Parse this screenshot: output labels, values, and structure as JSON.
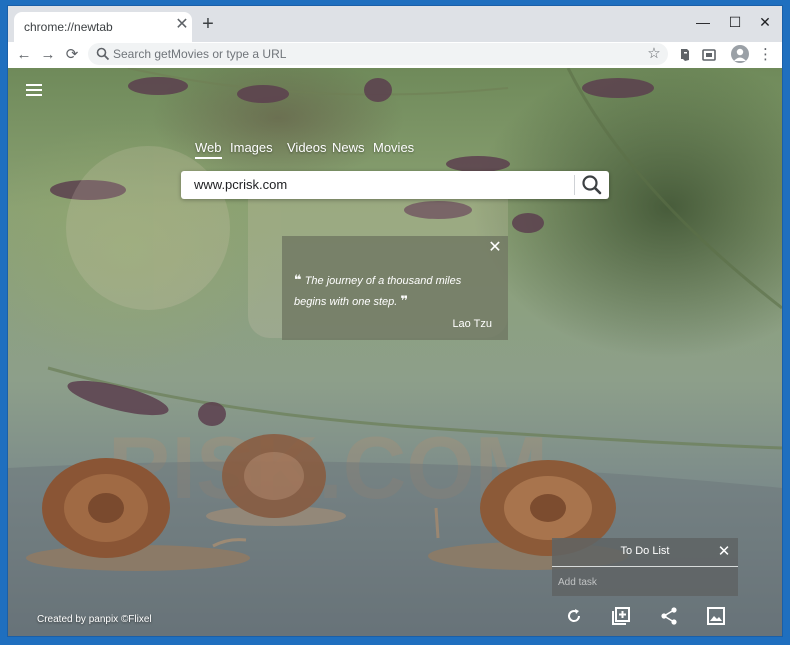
{
  "browser": {
    "tab_title": "chrome://newtab",
    "tab_close": "✕",
    "new_tab": "+",
    "window_controls": {
      "minimize": "—",
      "maximize": "☐",
      "close": "✕"
    },
    "nav": {
      "back": "←",
      "forward": "→",
      "reload": "⟳"
    },
    "address_placeholder": "Search getMovies or type a URL",
    "bookmark_star": "☆",
    "menu": "⋮",
    "icons": [
      "search-icon",
      "star-icon",
      "evernote-extension-icon",
      "cast-extension-icon",
      "profile-icon"
    ]
  },
  "page": {
    "search_tabs": [
      "Web",
      "Images",
      "Videos",
      "News",
      "Movies"
    ],
    "active_tab": "Web",
    "search_value": "www.pcrisk.com",
    "quote": {
      "open_mark": "❝",
      "text": "The journey of a thousand miles begins with one step.",
      "close_mark": "❞",
      "author": "Lao Tzu",
      "close": "✕"
    },
    "todo": {
      "title": "To Do List",
      "close": "✕",
      "placeholder": "Add task"
    },
    "credit": "Created by panpix ©Flixel",
    "bottom_icons": [
      "refresh-icon",
      "add-box-icon",
      "share-icon",
      "image-icon"
    ]
  },
  "colors": {
    "titlebar": "#dee1e6",
    "toolbar": "#ffffff",
    "desktop": "#1f6fbf"
  }
}
